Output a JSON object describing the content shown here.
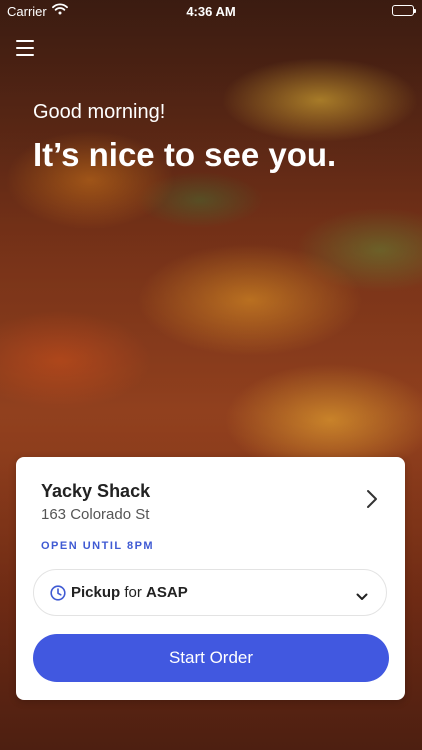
{
  "status_bar": {
    "carrier": "Carrier",
    "time": "4:36 AM",
    "battery_level": 1.0
  },
  "icons": {
    "menu": "hamburger-menu-icon",
    "wifi": "wifi-icon",
    "battery": "battery-icon",
    "chevron_right": "chevron-right-icon",
    "clock": "clock-icon",
    "chevron_down": "chevron-down-icon"
  },
  "hero": {
    "greeting": "Good morning!",
    "headline": "It’s nice to see you."
  },
  "store": {
    "name": "Yacky Shack",
    "address": "163 Colorado St",
    "hours": "OPEN UNTIL 8PM"
  },
  "order": {
    "method": "Pickup",
    "connector": "for",
    "time": "ASAP",
    "start_label": "Start Order"
  },
  "colors": {
    "accent": "#4158E0",
    "hours_text": "#3F5AD3"
  }
}
